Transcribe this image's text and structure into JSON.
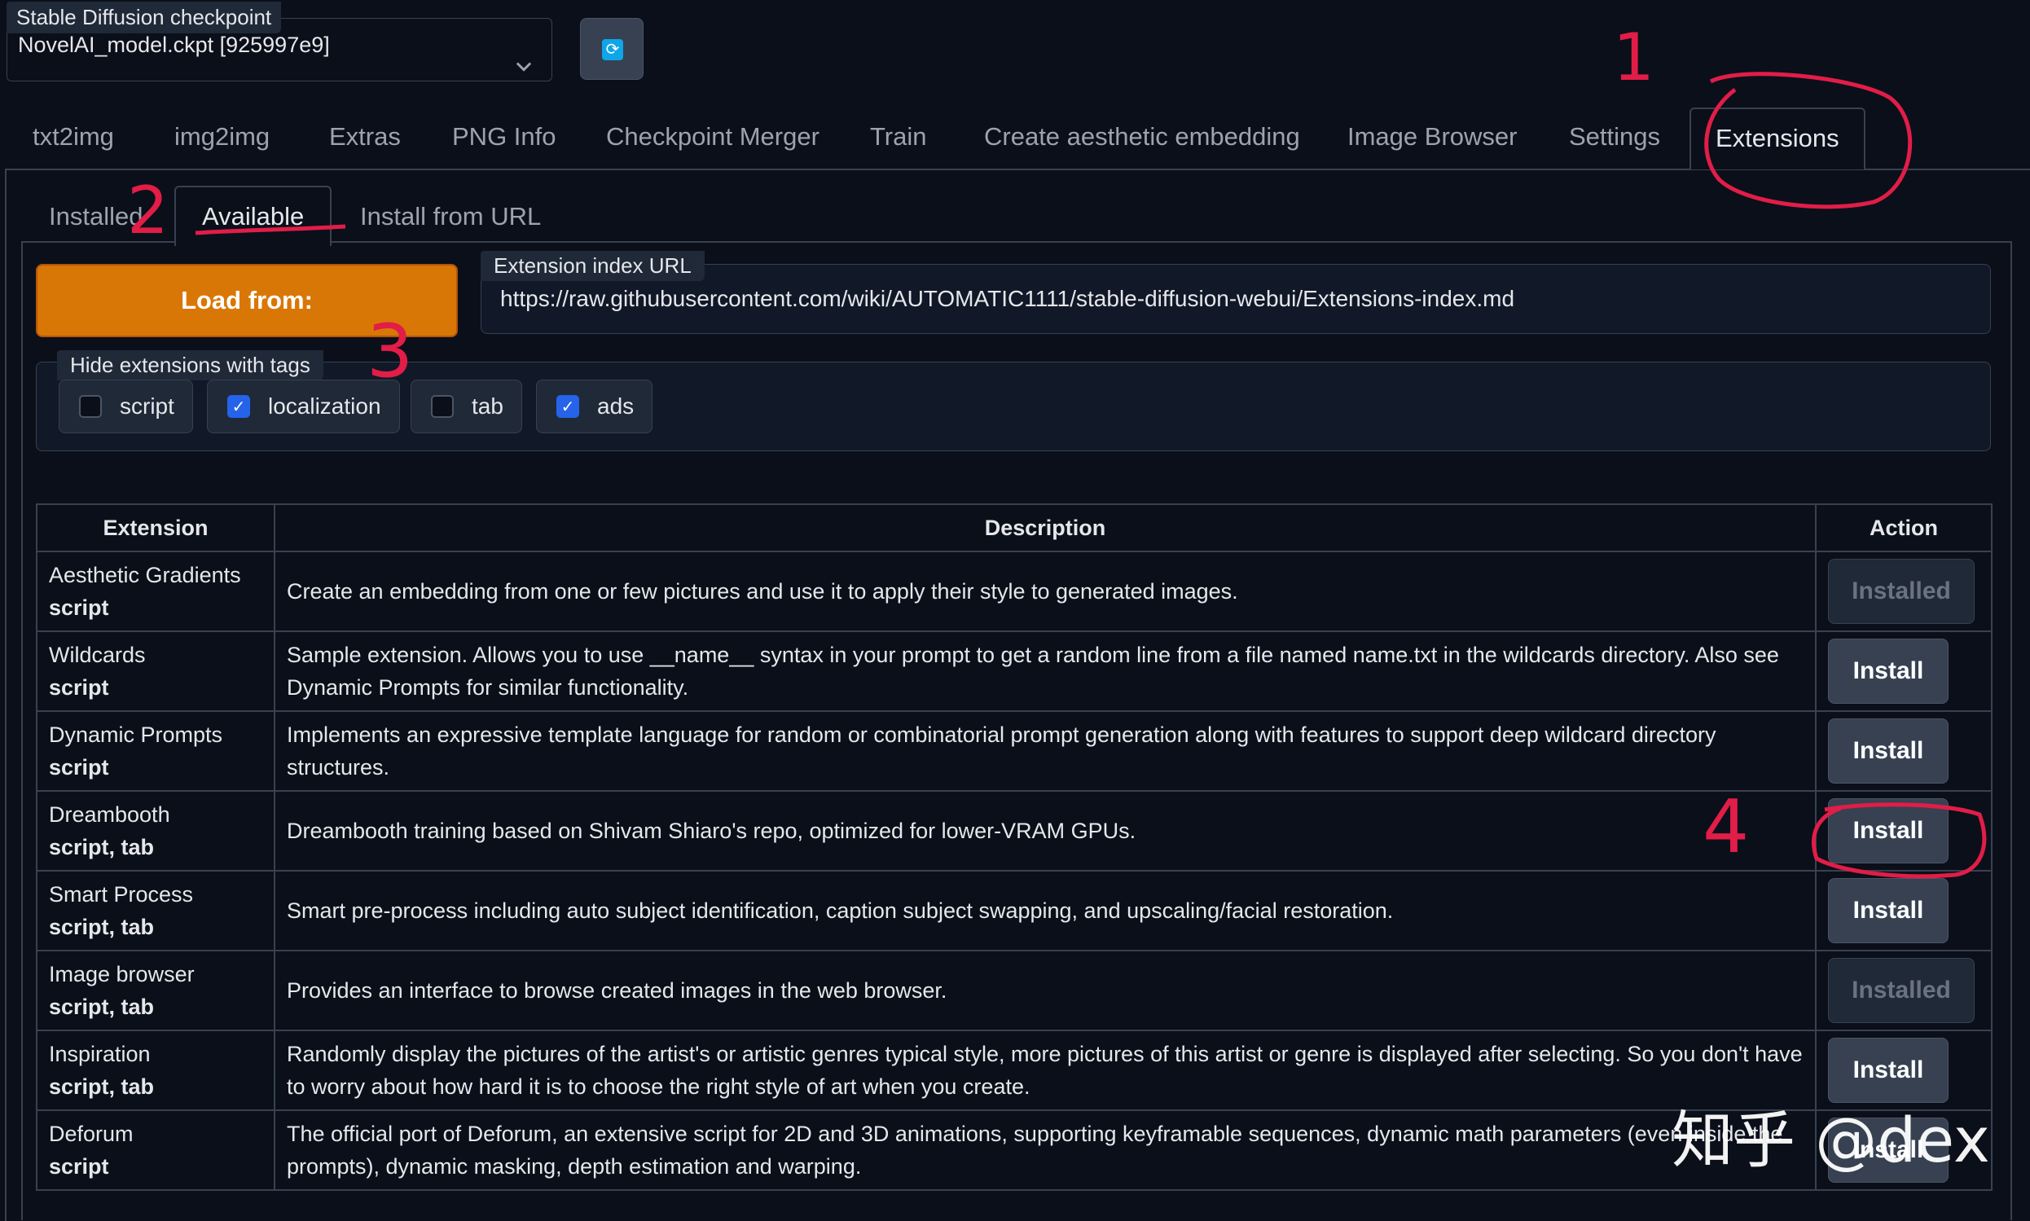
{
  "checkpoint": {
    "label": "Stable Diffusion checkpoint",
    "value": "NovelAI_model.ckpt [925997e9]"
  },
  "main_tabs": [
    "txt2img",
    "img2img",
    "Extras",
    "PNG Info",
    "Checkpoint Merger",
    "Train",
    "Create aesthetic embedding",
    "Image Browser",
    "Settings",
    "Extensions"
  ],
  "sub_tabs": [
    "Installed",
    "Available",
    "Install from URL"
  ],
  "load_button": "Load from:",
  "index_url": {
    "label": "Extension index URL",
    "value": "https://raw.githubusercontent.com/wiki/AUTOMATIC1111/stable-diffusion-webui/Extensions-index.md"
  },
  "hide_tags": {
    "label": "Hide extensions with tags",
    "options": [
      {
        "label": "script",
        "checked": false
      },
      {
        "label": "localization",
        "checked": true
      },
      {
        "label": "tab",
        "checked": false
      },
      {
        "label": "ads",
        "checked": true
      }
    ]
  },
  "table": {
    "headers": [
      "Extension",
      "Description",
      "Action"
    ],
    "rows": [
      {
        "name": "Aesthetic Gradients",
        "tags": "script",
        "description": "Create an embedding from one or few pictures and use it to apply their style to generated images.",
        "action": "Installed"
      },
      {
        "name": "Wildcards",
        "tags": "script",
        "description": "Sample extension. Allows you to use __name__ syntax in your prompt to get a random line from a file named name.txt in the wildcards directory. Also see Dynamic Prompts for similar functionality.",
        "action": "Install"
      },
      {
        "name": "Dynamic Prompts",
        "tags": "script",
        "description": "Implements an expressive template language for random or combinatorial prompt generation along with features to support deep wildcard directory structures.",
        "action": "Install"
      },
      {
        "name": "Dreambooth",
        "tags": "script, tab",
        "description": "Dreambooth training based on Shivam Shiaro's repo, optimized for lower-VRAM GPUs.",
        "action": "Install"
      },
      {
        "name": "Smart Process",
        "tags": "script, tab",
        "description": "Smart pre-process including auto subject identification, caption subject swapping, and upscaling/facial restoration.",
        "action": "Install"
      },
      {
        "name": "Image browser",
        "tags": "script, tab",
        "description": "Provides an interface to browse created images in the web browser.",
        "action": "Installed"
      },
      {
        "name": "Inspiration",
        "tags": "script, tab",
        "description": "Randomly display the pictures of the artist's or artistic genres typical style, more pictures of this artist or genre is displayed after selecting. So you don't have to worry about how hard it is to choose the right style of art when you create.",
        "action": "Install"
      },
      {
        "name": "Deforum",
        "tags": "script",
        "description": "The official port of Deforum, an extensive script for 2D and 3D animations, supporting keyframable sequences, dynamic math parameters (even inside the prompts), dynamic masking, depth estimation and warping.",
        "action": "Install"
      }
    ]
  },
  "annotations": [
    "1",
    "2",
    "3",
    "4"
  ],
  "watermark": "知乎 @dex",
  "colors": {
    "background": "#0b0f19",
    "load_button": "#d97706",
    "checkbox_checked": "#2563eb",
    "annotation": "#e11d48",
    "refresh_icon": "#0ea5e9"
  }
}
